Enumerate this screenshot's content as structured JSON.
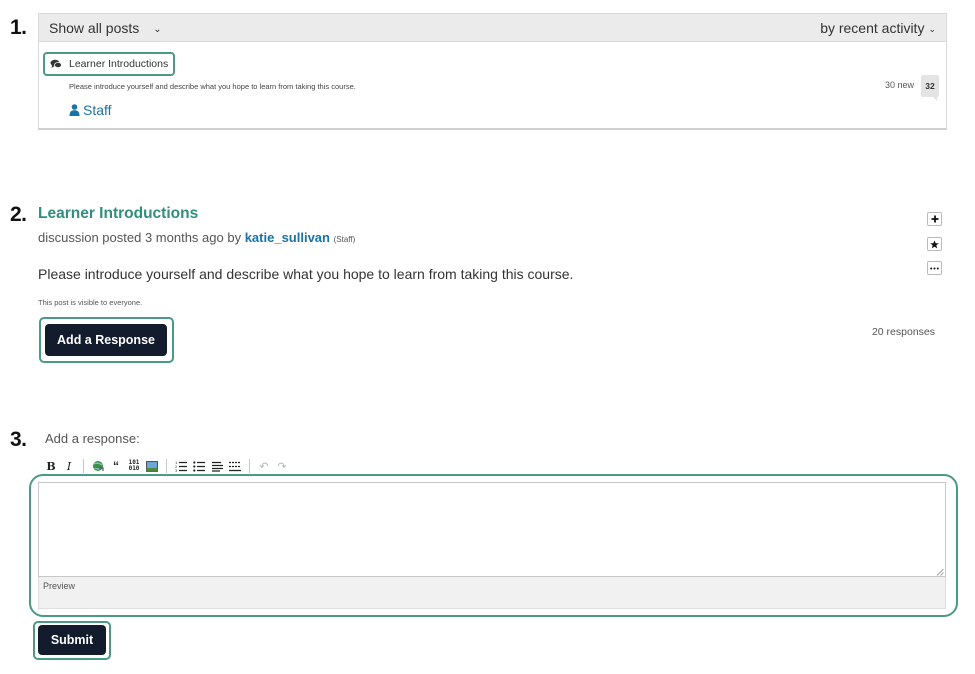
{
  "steps": {
    "one": "1.",
    "two": "2.",
    "three": "3."
  },
  "thread_list": {
    "filter_label": "Show all posts",
    "filter_icon": "chevron-down-icon",
    "sort_label": "by recent activity",
    "sort_icon": "chevron-down-icon",
    "thread": {
      "icon": "comments-icon",
      "title": "Learner Introductions",
      "preview": "Please introduce yourself and describe what you hope to learn from taking this course.",
      "author_icon": "user-icon",
      "author": "Staff",
      "new_count": "30 new",
      "comment_count": "32"
    }
  },
  "post": {
    "title": "Learner Introductions",
    "meta_prefix": "discussion posted 3 months ago by",
    "author": "katie_sullivan",
    "author_role": "(Staff)",
    "body": "Please introduce yourself and describe what you hope to learn from taking this course.",
    "visibility": "This post is visible to everyone.",
    "add_response_label": "Add a Response",
    "responses_count": "20 responses",
    "actions": [
      "plus-icon",
      "star-icon",
      "more-icon"
    ]
  },
  "response_form": {
    "label": "Add a response:",
    "toolbar": [
      "bold",
      "italic",
      "link",
      "quote",
      "code",
      "image",
      "numbered-list",
      "bulleted-list",
      "heading",
      "horizontal-rule",
      "undo",
      "redo"
    ],
    "textarea_value": "",
    "preview_label": "Preview",
    "submit_label": "Submit"
  },
  "colors": {
    "accent_outline": "#4a9a85",
    "title_green": "#2e8f7f",
    "link_blue": "#1a72a8",
    "button_dark": "#121c2c"
  }
}
